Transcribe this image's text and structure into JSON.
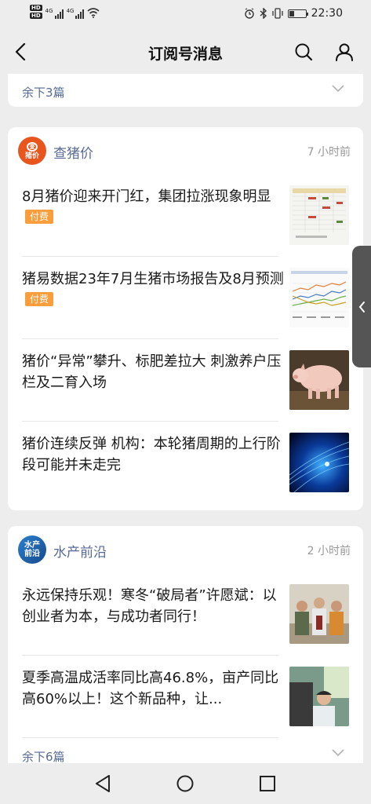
{
  "status_bar": {
    "sim1_badge": "HD",
    "sim2_badge": "HD",
    "sig1_label": "4G",
    "sig2_label": "4G",
    "time": "22:30"
  },
  "header": {
    "title": "订阅号消息"
  },
  "top_card": {
    "more_label": "余下3篇"
  },
  "accounts": [
    {
      "name": "查猪价",
      "logo_top": "查",
      "logo_bottom": "猪价",
      "time": "7 小时前",
      "articles": [
        {
          "title": "8月猪价迎来开门红，集团拉涨现象明显",
          "paid": "付费"
        },
        {
          "title": "猪易数据23年7月生猪市场报告及8月预测",
          "paid": "付费"
        },
        {
          "title": "猪价“异常”攀升、标肥差拉大 刺激养户压栏及二育入场"
        },
        {
          "title": "猪价连续反弹 机构：本轮猪周期的上行阶段可能并未走完"
        }
      ]
    },
    {
      "name": "水产前沿",
      "logo_top": "水产",
      "logo_bottom": "前沿",
      "time": "2 小时前",
      "articles": [
        {
          "title": "永远保持乐观！寒冬“破局者”许愿斌：以创业者为本，与成功者同行！"
        },
        {
          "title": "夏季高温成活率同比高46.8%，亩产同比高60%以上！这个新品种，让..."
        }
      ],
      "more_label": "余下6篇"
    }
  ],
  "colors": {
    "accent_link": "#576b95",
    "paid_badge": "#fa9d3b",
    "pig_logo": "#e8561e"
  }
}
